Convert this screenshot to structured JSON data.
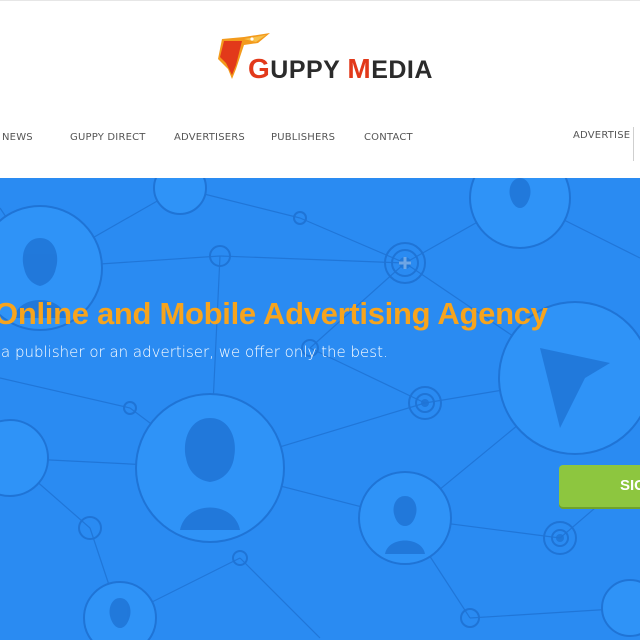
{
  "brand": {
    "logo_text_g": "G",
    "logo_text_uppy": "UPPY ",
    "logo_text_m": "M",
    "logo_text_edia": "EDIA",
    "accent_orange": "#f7a41d",
    "logo_red": "#e2391a",
    "hero_blue": "#2a8bf2",
    "cta_green": "#8dc63f"
  },
  "nav": {
    "items": [
      {
        "label": "NEWS"
      },
      {
        "label": "GUPPY DIRECT"
      },
      {
        "label": "ADVERTISERS"
      },
      {
        "label": "PUBLISHERS"
      },
      {
        "label": "CONTACT"
      }
    ],
    "right_label": "ADVERTISE"
  },
  "hero": {
    "title": "Online and Mobile Advertising Agency",
    "subtitle": "a publisher or an advertiser, we offer only the best.",
    "cta_label": "SIG"
  }
}
